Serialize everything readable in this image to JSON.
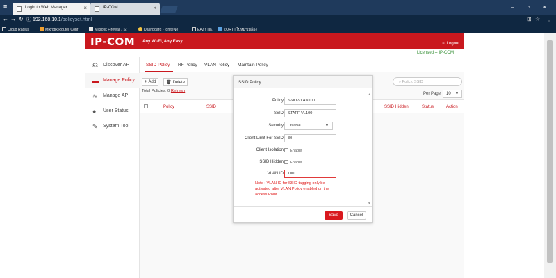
{
  "browser": {
    "tabs": [
      {
        "title": "Login to Web Manager"
      },
      {
        "title": "IP-COM"
      }
    ],
    "url_host": "192.168.10.1",
    "url_path": "/policyset.html",
    "bookmarks": [
      {
        "label": "Cloud Radius",
        "color": "#8c8c8c"
      },
      {
        "label": "Mikrotik Router Conf",
        "color": "#f0a030"
      },
      {
        "label": "Mikrotik Firewall / St",
        "color": "#e8e8e8"
      },
      {
        "label": "Dashboard - IgniteNe",
        "color": "#f5c542"
      },
      {
        "label": "EAZYTIK",
        "color": "#8c8c8c"
      },
      {
        "label": "ZORT | ใบหมาเหลือง",
        "color": "#5aa0e0"
      }
    ]
  },
  "header": {
    "logo": "IP-COM",
    "tagline": "Any Wi-Fi, Any Easy",
    "logout": "Logout",
    "licensed": "Licensed -- IP-COM"
  },
  "sidebar": {
    "items": [
      {
        "label": "Discover AP",
        "icon": "wifi-search-icon"
      },
      {
        "label": "Manage Policy",
        "icon": "policy-icon"
      },
      {
        "label": "Manage AP",
        "icon": "wifi-icon"
      },
      {
        "label": "User Status",
        "icon": "users-icon"
      },
      {
        "label": "System Tool",
        "icon": "wrench-icon"
      }
    ]
  },
  "main": {
    "tabs": [
      "SSID Policy",
      "RF Policy",
      "VLAN Policy",
      "Maintain Policy"
    ],
    "add_label": "Add",
    "delete_label": "Delete",
    "search_placeholder": "Policy, SSID",
    "total_label": "Total Policies: 0",
    "refresh_label": "Refresh",
    "per_page_label": "Per Page",
    "per_page_value": "10",
    "columns": [
      "Policy",
      "SSID",
      "SSID Hidden",
      "Status",
      "Action"
    ]
  },
  "modal": {
    "title": "SSID Policy",
    "policy_label": "Policy",
    "policy_value": "SSID-VLAN100",
    "ssid_label": "SSID",
    "ssid_value": "STAFF-VL100",
    "security_label": "Security",
    "security_value": "Disable",
    "client_limit_label": "Client Limit For SSID",
    "client_limit_value": "30",
    "client_isolation_label": "Client Isolation",
    "ssid_hidden_label": "SSID Hidden",
    "enable_label": "Enable",
    "vlan_id_label": "VLAN ID",
    "vlan_id_value": "100",
    "note": "Note : VLAN ID for SSID tagging only be activated after VLAN Policy enabled on the access Point.",
    "save_label": "Save",
    "cancel_label": "Cancel"
  },
  "colors": {
    "brand": "#c9181e",
    "licensed": "#2e8b2e",
    "note": "#e02020"
  }
}
